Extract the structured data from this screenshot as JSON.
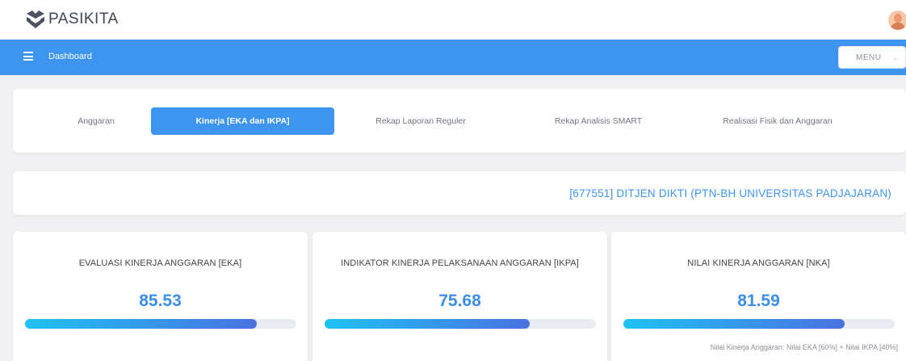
{
  "app": {
    "brand": "PASIKITA",
    "nav_title": "Dashboard",
    "menu_label": "MENU",
    "colors": {
      "primary": "#3d95f0",
      "value": "#3d8ee8",
      "bar_start": "#1fc2f5",
      "bar_end": "#4a72e0"
    }
  },
  "tabs": [
    {
      "label": "Anggaran",
      "active": false
    },
    {
      "label": "Kinerja [EKA dan IKPA]",
      "active": true
    },
    {
      "label": "Rekap Laporan Reguler",
      "active": false
    },
    {
      "label": "Rekap Analisis SMART",
      "active": false
    },
    {
      "label": "Realisasi Fisik dan Anggaran",
      "active": false
    }
  ],
  "unit": "[677551] DITJEN DIKTI (PTN-BH UNIVERSITAS PADJAJARAN)",
  "metrics": [
    {
      "title": "EVALUASI KINERJA ANGGARAN [EKA]",
      "value": "85.53",
      "progress": 85.53
    },
    {
      "title": "INDIKATOR KINERJA PELAKSANAAN ANGGARAN [IKPA]",
      "value": "75.68",
      "progress": 75.68
    },
    {
      "title": "NILAI KINERJA ANGGARAN [NKA]",
      "value": "81.59",
      "progress": 81.59
    }
  ],
  "nka_formula": "Nilai Kinerja Anggaran: Nilai EKA [60%] + Nilai IKPA [40%]"
}
